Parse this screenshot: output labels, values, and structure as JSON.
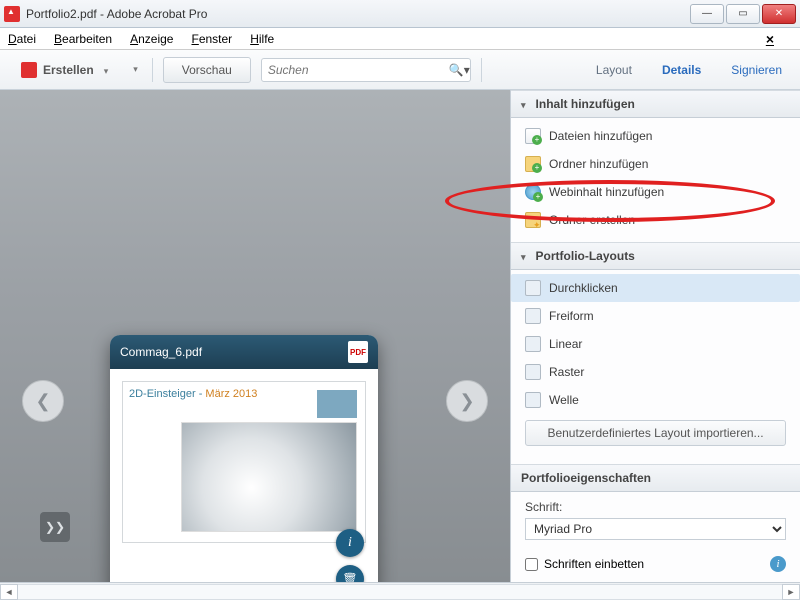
{
  "window": {
    "title": "Portfolio2.pdf - Adobe Acrobat Pro"
  },
  "menu": {
    "file": "Datei",
    "edit": "Bearbeiten",
    "view": "Anzeige",
    "window": "Fenster",
    "help": "Hilfe"
  },
  "toolbar": {
    "create": "Erstellen",
    "preview": "Vorschau",
    "search_placeholder": "Suchen",
    "layout": "Layout",
    "details": "Details",
    "sign": "Signieren"
  },
  "card": {
    "filename": "Commag_6.pdf",
    "pdf_badge": "PDF",
    "doc_heading_a": "2D-Einsteiger - ",
    "doc_heading_b": "März 2013"
  },
  "panel": {
    "section_content": "Inhalt hinzufügen",
    "add_files": "Dateien hinzufügen",
    "add_folder": "Ordner hinzufügen",
    "add_web": "Webinhalt hinzufügen",
    "new_folder": "Ordner erstellen",
    "section_layouts": "Portfolio-Layouts",
    "layout_click": "Durchklicken",
    "layout_free": "Freiform",
    "layout_linear": "Linear",
    "layout_grid": "Raster",
    "layout_wave": "Welle",
    "import_layout": "Benutzerdefiniertes Layout importieren...",
    "section_props": "Portfolioeigenschaften",
    "font_label": "Schrift:",
    "font_value": "Myriad Pro",
    "embed_fonts": "Schriften einbetten"
  }
}
